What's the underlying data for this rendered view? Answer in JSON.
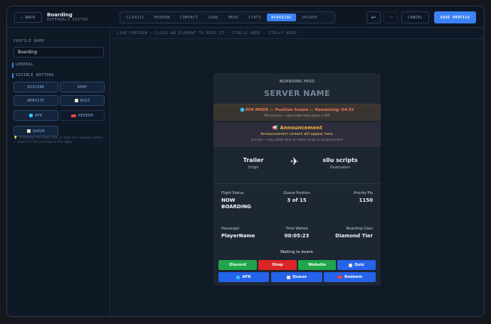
{
  "header": {
    "back_label": "BACK",
    "back_icon": "arrow-left-icon",
    "title": "Boarding",
    "subtitle": "DEFERRALS EDITOR",
    "tabs": [
      "CLASSIC",
      "MODERN",
      "COMPACT",
      "CARD",
      "HERO",
      "STATS",
      "BOARDING",
      "SPLASH"
    ],
    "active_tab": "BOARDING",
    "undo_icon": "undo-icon",
    "redo_icon": "redo-icon",
    "cancel_label": "CANCEL",
    "save_label": "SAVE PROFILE"
  },
  "sidebar": {
    "profile_name_label": "PROFILE NAME",
    "profile_name_value": "Boarding",
    "general_label": "GENERAL",
    "visible_buttons_label": "VISIBLE BUTTONS",
    "buttons": [
      {
        "label": "DISCORD",
        "icon": ""
      },
      {
        "label": "SHOP",
        "icon": ""
      },
      {
        "label": "WEBSITE",
        "icon": ""
      },
      {
        "label": "QUIZ",
        "icon": "quiz-icon"
      },
      {
        "label": "AFK",
        "icon": "afk-icon"
      },
      {
        "label": "REDEEM",
        "icon": "redeem-icon"
      },
      {
        "label": "QUEUE",
        "icon": "queue-icon"
      }
    ],
    "hint": "To change the label, URL or style of a specific button — click it in the preview on the right."
  },
  "preview": {
    "bar_text": "LIVE PREVIEW — CLICK AN ELEMENT TO EDIT IT · CTRL+Z UNDO · CTRL+Y REDO"
  },
  "card": {
    "pass_label": "BOARDING PASS",
    "server_name": "SERVER NAME",
    "afk_main": "AFK MODE — Position frozen — Remaining: 04:32",
    "afk_sub": "AFK preview — only visible while player is AFK",
    "announcement_title": "Announcement",
    "announcement_body": "Announcement content will appear here.",
    "announcement_sub": "preview — only visible when an admin sends an announcement",
    "origin_name": "Trailer",
    "origin_label": "Origin",
    "destination_name": "s0u scripts",
    "destination_label": "Destination",
    "flight_status_label": "Flight Status",
    "flight_status_value": "NOW BOARDING",
    "queue_position_label": "Queue Position",
    "queue_position_value": "3 of 15",
    "priority_label": "Priority Pts",
    "priority_value": "1150",
    "passenger_label": "Passenger",
    "passenger_value": "PlayerName",
    "time_waited_label": "Time Waited",
    "time_waited_value": "00:05:23",
    "boarding_class_label": "Boarding Class",
    "boarding_class_value": "Diamond Tier",
    "waiting_text": "Waiting to board.",
    "buttons": [
      {
        "label": "Discord",
        "color": "#1fa64a"
      },
      {
        "label": "Shop",
        "color": "#dc2626"
      },
      {
        "label": "Website",
        "color": "#1fa64a"
      },
      {
        "label": "Quiz",
        "color": "#2563eb"
      },
      {
        "label": "AFK",
        "color": "#2563eb"
      },
      {
        "label": "Queue",
        "color": "#2563eb"
      },
      {
        "label": "Redeem",
        "color": "#2563eb"
      }
    ]
  },
  "colors": {
    "accent": "#3b82f6",
    "background": "#0f1825",
    "card": "#1d2633"
  }
}
